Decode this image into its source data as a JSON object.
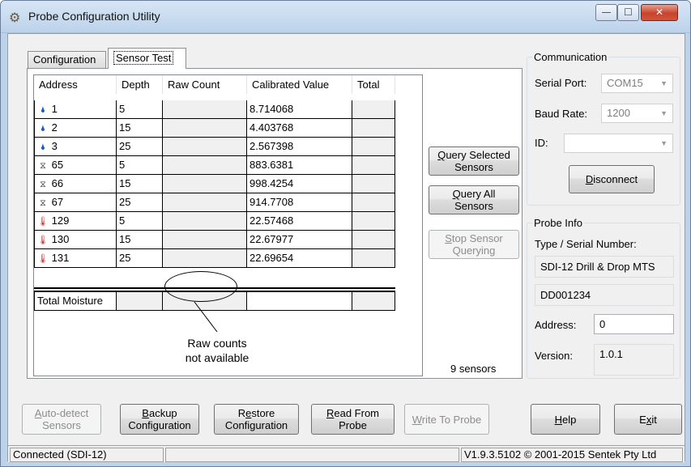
{
  "window": {
    "title": "Probe Configuration Utility",
    "minimize": "—",
    "maximize": "☐",
    "close": "✕"
  },
  "tabs": {
    "configuration": "Configuration",
    "sensor_test": "Sensor Test"
  },
  "grid": {
    "headers": [
      "Address",
      "Depth",
      "Raw Count",
      "Calibrated Value",
      "Total"
    ],
    "rows": [
      {
        "icon": "water-drop-icon",
        "address": "1",
        "depth": "5",
        "raw": "",
        "calibrated": "8.714068",
        "total": ""
      },
      {
        "icon": "water-drop-icon",
        "address": "2",
        "depth": "15",
        "raw": "",
        "calibrated": "4.403768",
        "total": ""
      },
      {
        "icon": "water-drop-icon",
        "address": "3",
        "depth": "25",
        "raw": "",
        "calibrated": "2.567398",
        "total": ""
      },
      {
        "icon": "salinity-icon",
        "address": "65",
        "depth": "5",
        "raw": "",
        "calibrated": "883.6381",
        "total": ""
      },
      {
        "icon": "salinity-icon",
        "address": "66",
        "depth": "15",
        "raw": "",
        "calibrated": "998.4254",
        "total": ""
      },
      {
        "icon": "salinity-icon",
        "address": "67",
        "depth": "25",
        "raw": "",
        "calibrated": "914.7708",
        "total": ""
      },
      {
        "icon": "thermometer-icon",
        "address": "129",
        "depth": "5",
        "raw": "",
        "calibrated": "22.57468",
        "total": ""
      },
      {
        "icon": "thermometer-icon",
        "address": "130",
        "depth": "15",
        "raw": "",
        "calibrated": "22.67977",
        "total": ""
      },
      {
        "icon": "thermometer-icon",
        "address": "131",
        "depth": "25",
        "raw": "",
        "calibrated": "22.69654",
        "total": ""
      }
    ],
    "total_row_label": "Total Moisture"
  },
  "annotation": {
    "line1": "Raw counts",
    "line2": "not available"
  },
  "sensor_buttons": {
    "query_selected_1": "Q",
    "query_selected_2": "uery Selected",
    "query_selected_3": "Sensors",
    "query_all_1": "Q",
    "query_all_2": "uery All",
    "query_all_3": "Sensors",
    "stop_1": "S",
    "stop_2": "top Sensor",
    "stop_3": "Querying"
  },
  "sensor_count": "9 sensors",
  "communication": {
    "title": "Communication",
    "serial_port_label": "Serial Port:",
    "serial_port_value": "COM15",
    "baud_rate_label": "Baud Rate:",
    "baud_rate_value": "1200",
    "id_label": "ID:",
    "id_value": "",
    "disconnect_1": "D",
    "disconnect_2": "isconnect"
  },
  "probe_info": {
    "title": "Probe Info",
    "type_label": "Type / Serial Number:",
    "type_value": "SDI-12 Drill & Drop MTS",
    "serial_value": "DD001234",
    "address_label": "Address:",
    "address_value": "0",
    "version_label": "Version:",
    "version_value": "1.0.1"
  },
  "bottom_buttons": {
    "auto_detect_1": "A",
    "auto_detect_2": "uto-detect",
    "auto_detect_3": "Sensors",
    "backup_1": "B",
    "backup_2": "ackup",
    "backup_3": "Configuration",
    "restore_1": "R",
    "restore_2": "e",
    "restore_3": "store",
    "restore_4": "Configuration",
    "read_1": "R",
    "read_2": "ead From",
    "read_3": "Probe",
    "write_1": "W",
    "write_2": "rite To Probe",
    "help_1": "H",
    "help_2": "elp",
    "exit_1": "E",
    "exit_2": "x",
    "exit_3": "it"
  },
  "status": {
    "connection": "Connected (SDI-12)",
    "middle": "",
    "version": "V1.9.3.5102 © 2001-2015 Sentek Pty Ltd"
  },
  "colors": {
    "water_icon": "#1a58c4",
    "temperature_icon": "#c0221b",
    "window_frame": "#bcd3ea"
  }
}
